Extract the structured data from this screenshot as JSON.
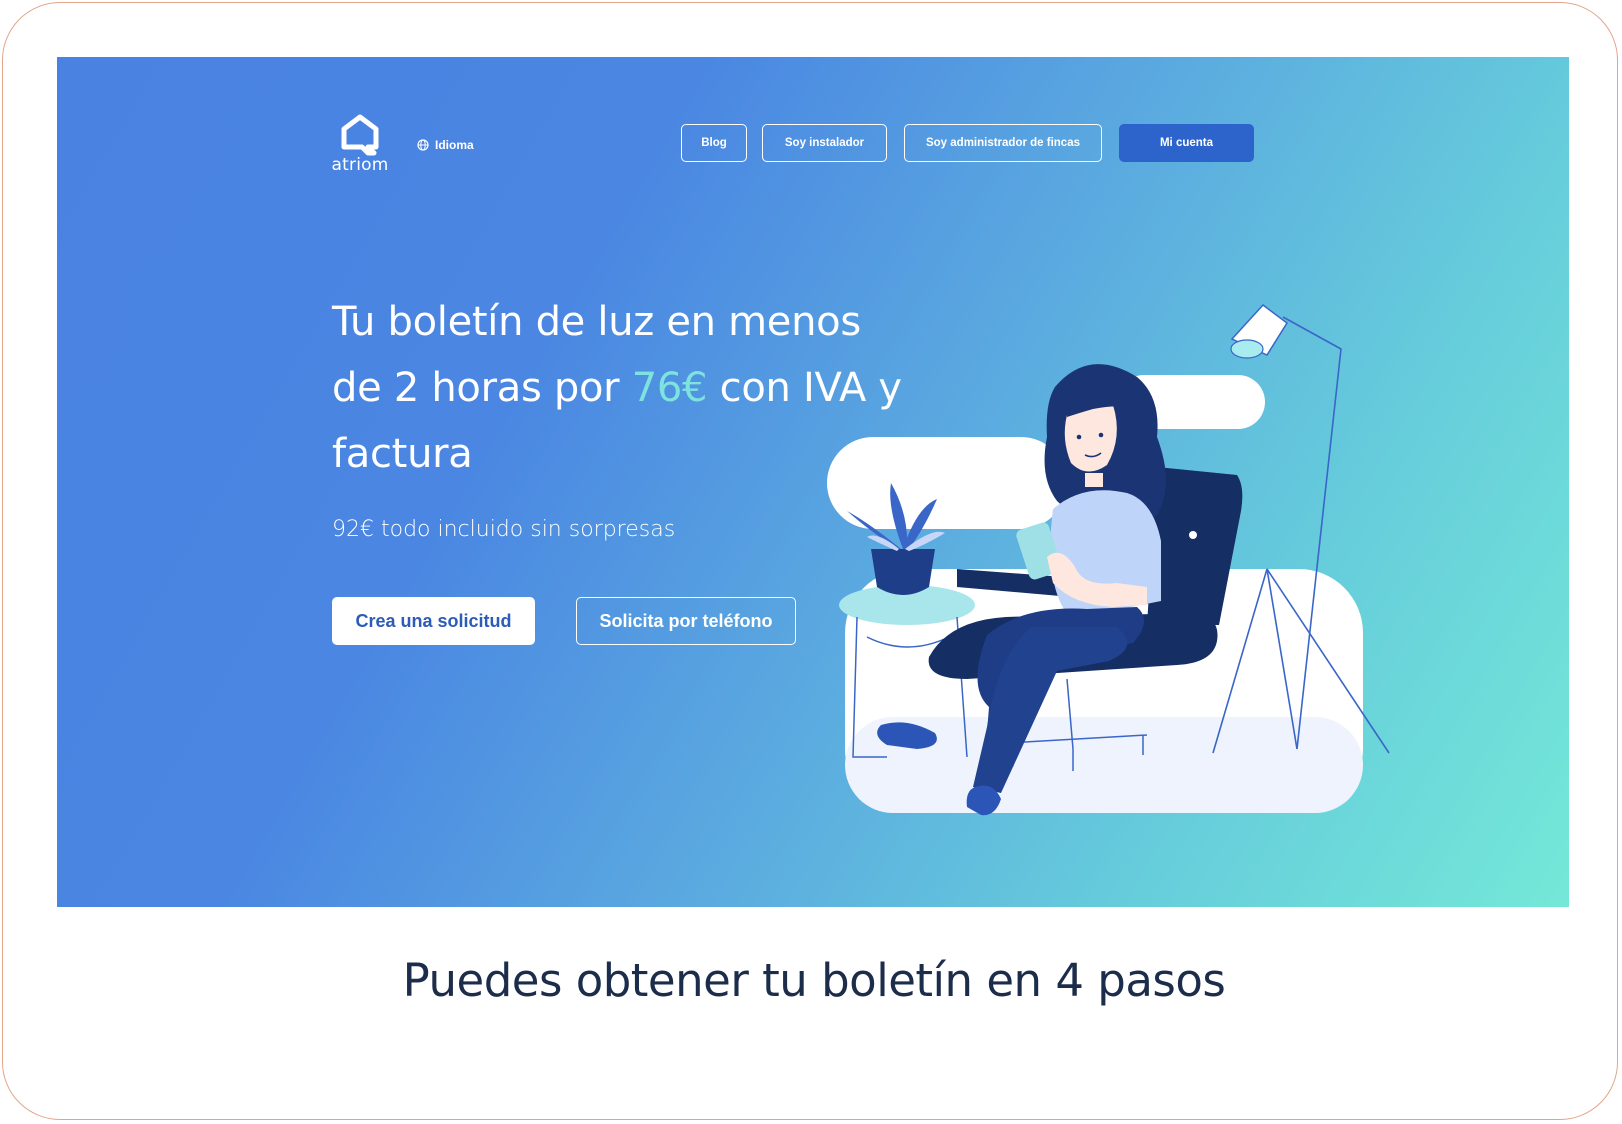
{
  "brand": {
    "name": "atriom"
  },
  "header": {
    "language_label": "Idioma",
    "nav": {
      "blog": "Blog",
      "installer": "Soy instalador",
      "admin": "Soy administrador de fincas",
      "account": "Mi cuenta"
    }
  },
  "hero": {
    "headline_part1": "Tu boletín de luz  en menos de 2 horas por",
    "headline_price": "76€",
    "headline_part2": "con IVA y factura",
    "subtitle": "92€ todo incluido sin sorpresas",
    "cta_primary": "Crea una solicitud",
    "cta_secondary": "Solicita por teléfono"
  },
  "section": {
    "title": "Puedes obtener tu boletín en 4 pasos"
  },
  "colors": {
    "gradient_start": "#4a82e2",
    "gradient_end": "#74e8d8",
    "accent_price": "#7ee3de",
    "primary_button": "#2d64cc",
    "title_dark": "#1c2d4b"
  },
  "icons": {
    "globe": "globe-icon",
    "logo": "atriom-logo-icon"
  }
}
